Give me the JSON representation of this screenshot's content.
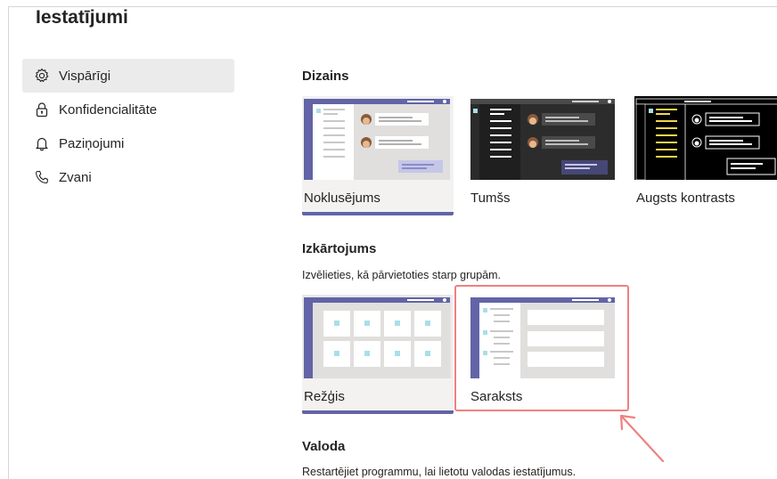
{
  "page": {
    "title": "Iestatījumi"
  },
  "sidebar": {
    "items": [
      {
        "label": "Vispārīgi",
        "icon": "gear-icon",
        "active": true
      },
      {
        "label": "Konfidencialitāte",
        "icon": "lock-icon",
        "active": false
      },
      {
        "label": "Paziņojumi",
        "icon": "bell-icon",
        "active": false
      },
      {
        "label": "Zvani",
        "icon": "phone-icon",
        "active": false
      }
    ]
  },
  "theme": {
    "title": "Dizains",
    "options": [
      {
        "label": "Noklusējums",
        "selected": true
      },
      {
        "label": "Tumšs",
        "selected": false
      },
      {
        "label": "Augsts kontrasts",
        "selected": false
      }
    ]
  },
  "layout": {
    "title": "Izkārtojums",
    "description": "Izvēlieties, kā pārvietoties starp grupām.",
    "options": [
      {
        "label": "Režģis",
        "selected": true
      },
      {
        "label": "Saraksts",
        "selected": false,
        "highlighted": true
      }
    ]
  },
  "language": {
    "title": "Valoda",
    "description": "Restartējiet programmu, lai lietotu valodas iestatījumus."
  },
  "colors": {
    "accent": "#6264a7",
    "highlight": "#f08080"
  }
}
